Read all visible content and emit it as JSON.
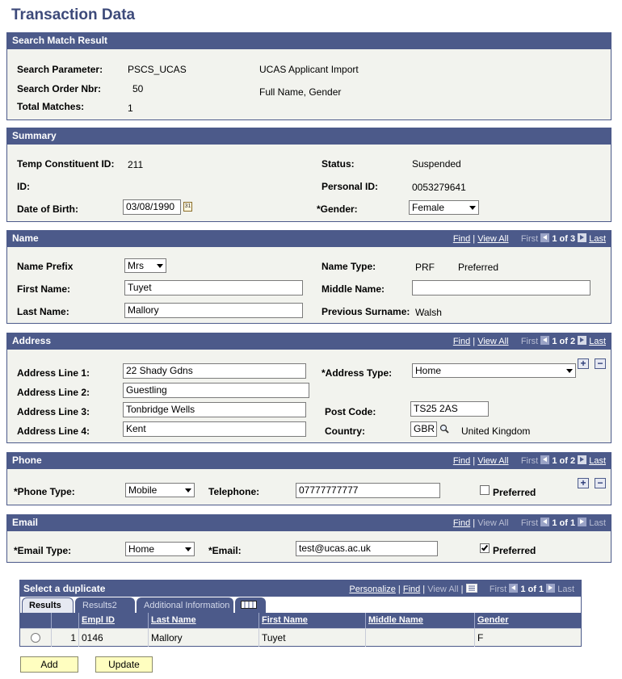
{
  "page": {
    "title": "Transaction Data"
  },
  "search": {
    "header": "Search Match Result",
    "param_label": "Search Parameter:",
    "param_value": "PSCS_UCAS",
    "param_desc": "UCAS Applicant Import",
    "order_label": "Search Order Nbr:",
    "order_value": "50",
    "order_desc": "Full Name, Gender",
    "matches_label": "Total Matches:",
    "matches_value": "1"
  },
  "summary": {
    "header": "Summary",
    "temp_label": "Temp Constituent ID:",
    "temp_value": "211",
    "status_label": "Status:",
    "status_value": "Suspended",
    "id_label": "ID:",
    "personal_label": "Personal ID:",
    "personal_value": "0053279641",
    "dob_label": "Date of Birth:",
    "dob_value": "03/08/1990",
    "gender_label": "*Gender:",
    "gender_value": "Female"
  },
  "nav": {
    "find": "Find",
    "sep": "|",
    "view_all": "View All",
    "first": "First",
    "last": "Last",
    "name_count": "1 of 3",
    "address_count": "1 of 2",
    "phone_count": "1 of 2",
    "email_count": "1 of 1"
  },
  "name": {
    "header": "Name",
    "prefix_label": "Name Prefix",
    "prefix_value": "Mrs",
    "type_label": "Name Type:",
    "type_code": "PRF",
    "type_desc": "Preferred",
    "first_label": "First Name:",
    "first_value": "Tuyet",
    "middle_label": "Middle Name:",
    "middle_value": "",
    "last_label": "Last Name:",
    "last_value": "Mallory",
    "prev_label": "Previous Surname:",
    "prev_value": "Walsh"
  },
  "address": {
    "header": "Address",
    "line1_label": "Address Line 1:",
    "line1_value": "22 Shady Gdns",
    "type_label": "*Address Type:",
    "type_value": "Home",
    "line2_label": "Address Line 2:",
    "line2_value": "Guestling",
    "line3_label": "Address Line 3:",
    "line3_value": "Tonbridge Wells",
    "post_label": "Post Code:",
    "post_value": "TS25 2AS",
    "line4_label": "Address Line 4:",
    "line4_value": "Kent",
    "country_label": "Country:",
    "country_code": "GBR",
    "country_name": "United Kingdom"
  },
  "phone": {
    "header": "Phone",
    "type_label": "*Phone Type:",
    "type_value": "Mobile",
    "tel_label": "Telephone:",
    "tel_value": "07777777777",
    "preferred_label": "Preferred",
    "preferred_checked": false
  },
  "email": {
    "header": "Email",
    "type_label": "*Email Type:",
    "type_value": "Home",
    "email_label": "*Email:",
    "email_value": "test@ucas.ac.uk",
    "preferred_label": "Preferred",
    "preferred_checked": true
  },
  "duplicate": {
    "header": "Select a duplicate",
    "personalize": "Personalize",
    "find": "Find",
    "view_all": "View All",
    "first": "First",
    "count": "1 of 1",
    "last": "Last",
    "tabs": [
      "Results",
      "Results2",
      "Additional Information"
    ],
    "columns": [
      "Empl ID",
      "Last Name",
      "First Name",
      "Middle Name",
      "Gender"
    ],
    "rows": [
      {
        "num": "1",
        "emplid": "0146",
        "last": "Mallory",
        "first": "Tuyet",
        "middle": "",
        "gender": "F"
      }
    ]
  },
  "buttons": {
    "add": "Add",
    "update": "Update"
  }
}
